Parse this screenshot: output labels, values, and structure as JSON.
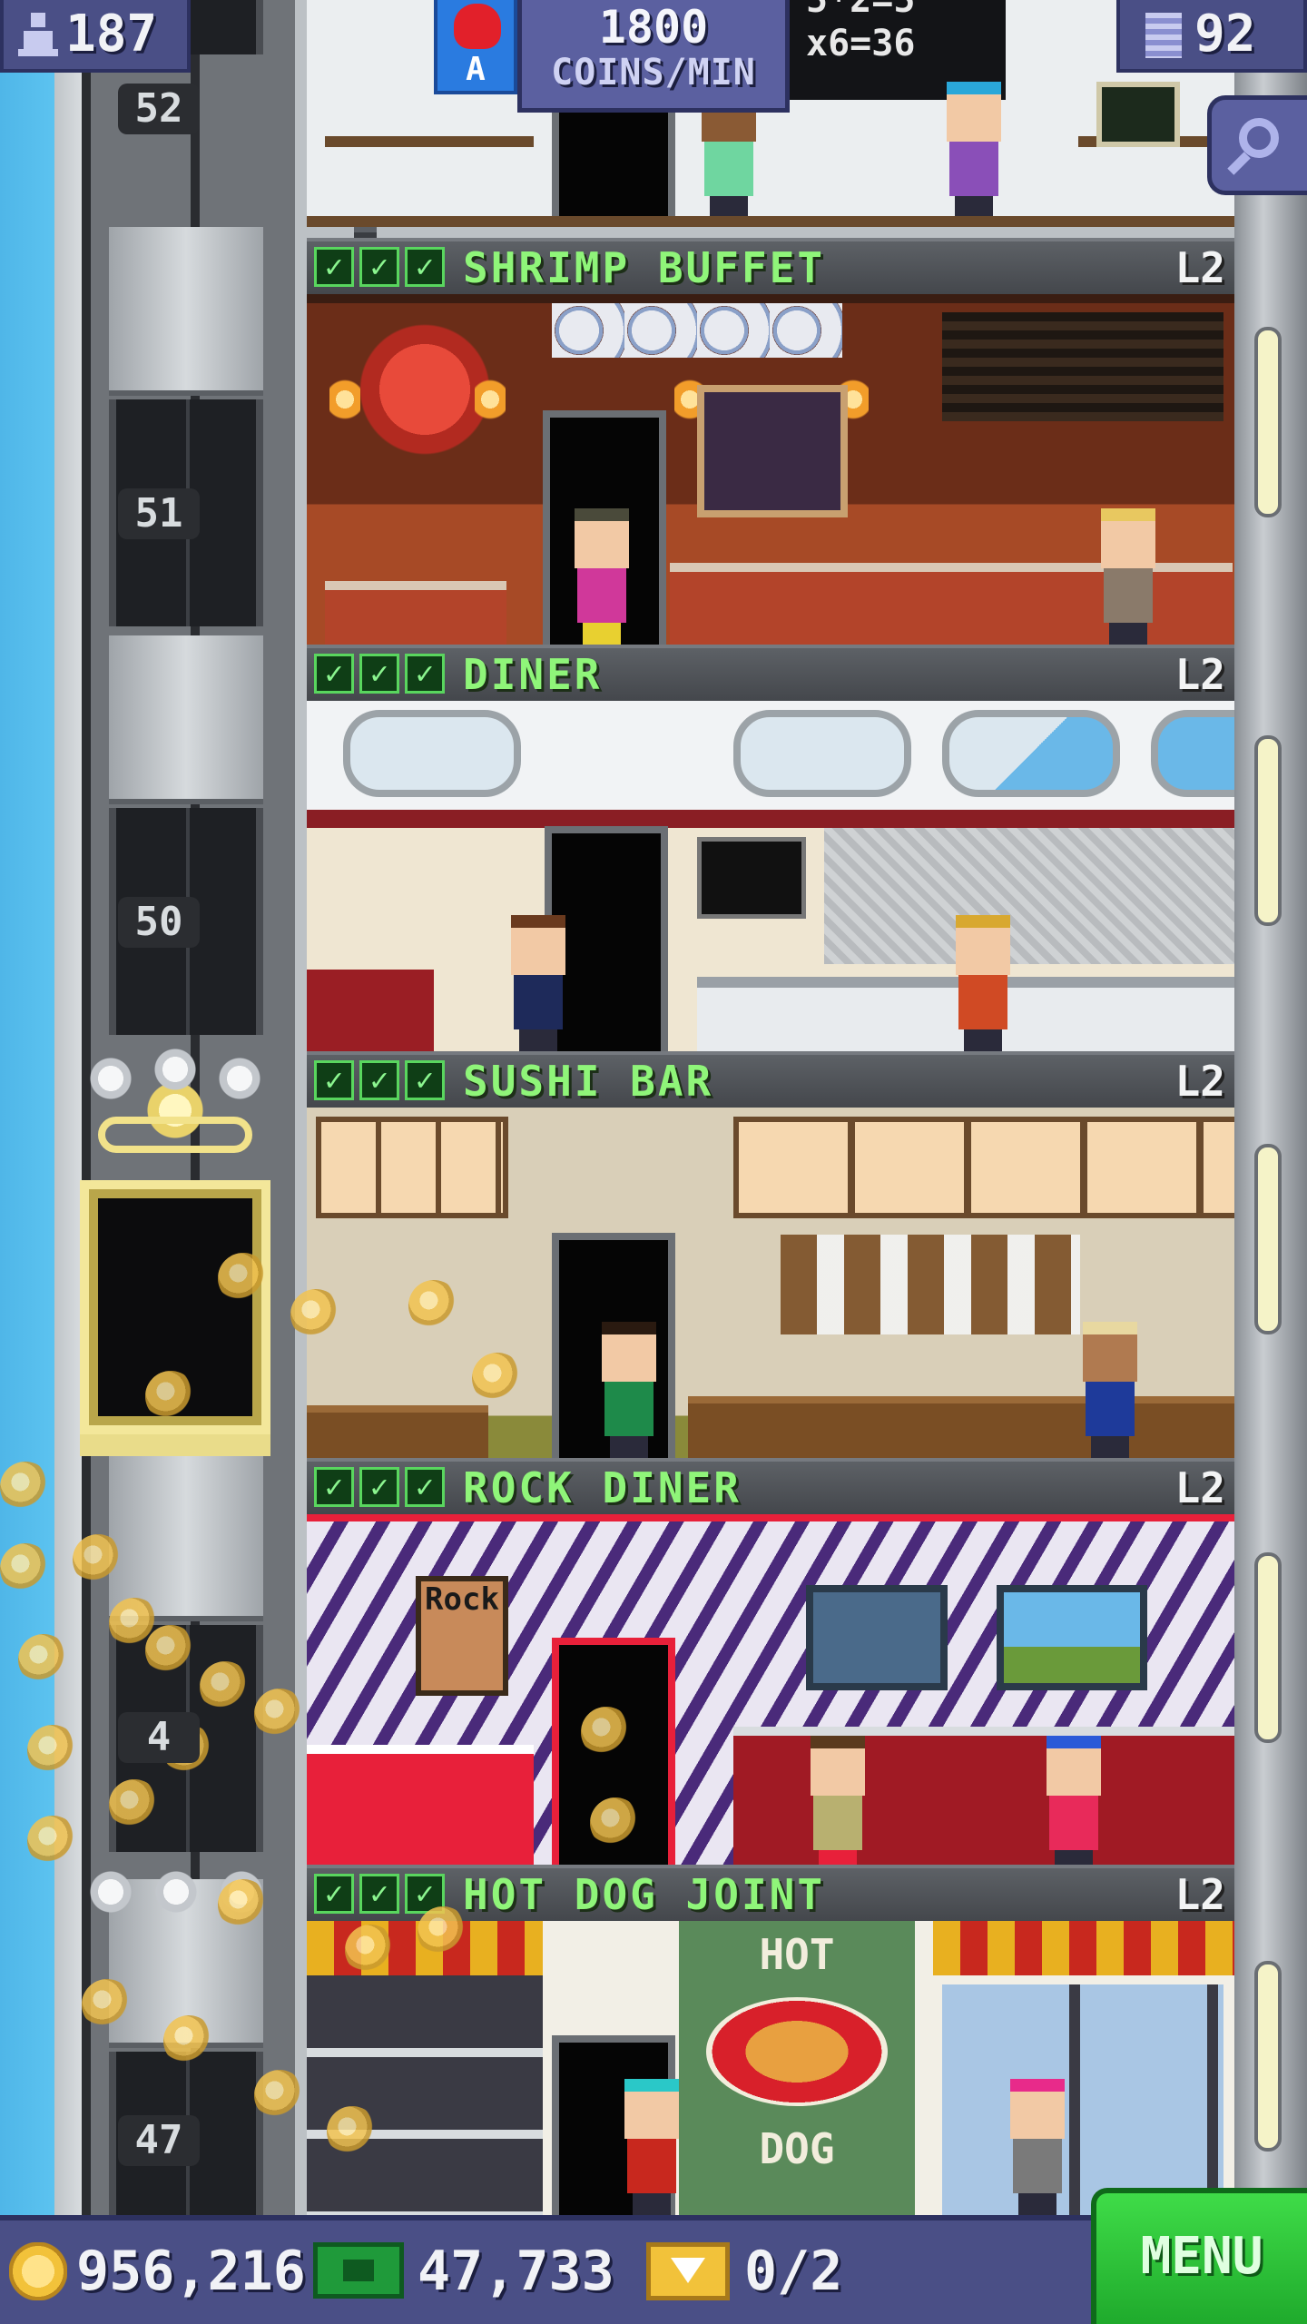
{
  "topbar": {
    "population": "187",
    "floors_count": "92",
    "coins_per_min_value": "1800",
    "coins_per_min_label": "COINS/MIN",
    "vip_letter": "A",
    "board_text_1": "5*2=5",
    "board_text_2": "x6=36"
  },
  "shaft": {
    "floor_numbers": [
      "52",
      "51",
      "50",
      "4",
      "47"
    ]
  },
  "floors": [
    {
      "name": "SHRIMP BUFFET",
      "level": "L2",
      "checks": [
        "✓",
        "✓",
        "✓"
      ]
    },
    {
      "name": "DINER",
      "level": "L2",
      "checks": [
        "✓",
        "✓",
        "✓"
      ]
    },
    {
      "name": "SUSHI BAR",
      "level": "L2",
      "checks": [
        "✓",
        "✓",
        "✓"
      ]
    },
    {
      "name": "ROCK DINER",
      "level": "L2",
      "checks": [
        "✓",
        "✓",
        "✓"
      ]
    },
    {
      "name": "HOT DOG JOINT",
      "level": "L2",
      "checks": [
        "✓",
        "✓",
        "✓"
      ]
    }
  ],
  "signs": {
    "rock_text": "Rock",
    "hotdog_top": "HOT",
    "hotdog_bottom": "DOG"
  },
  "bottombar": {
    "coins": "956,216",
    "bux": "47,733",
    "tickets": "0/2",
    "menu_label": "MENU"
  },
  "colors": {
    "accent_green": "#8ff579",
    "bar_purple": "#4a4f86",
    "menu_green": "#2fc23a"
  },
  "icons": {
    "population": "person-up-icon",
    "floors": "building-icon",
    "search": "search-icon",
    "coin": "coin-icon",
    "bux": "bux-icon",
    "ticket": "ticket-icon"
  }
}
